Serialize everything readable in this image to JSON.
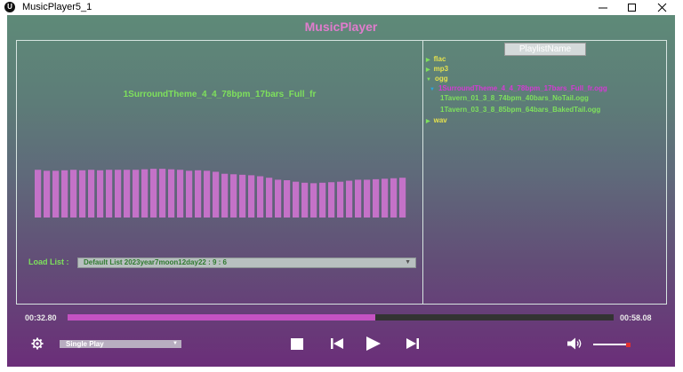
{
  "window": {
    "title": "MusicPlayer5_1",
    "icon_letter": "U"
  },
  "app": {
    "title": "MusicPlayer"
  },
  "now_playing": {
    "title": "1SurroundTheme_4_4_78bpm_17bars_Full_fr"
  },
  "spectrum": {
    "bar_color": "#c472c8",
    "levels": [
      0.96,
      0.94,
      0.94,
      0.95,
      0.96,
      0.95,
      0.96,
      0.95,
      0.96,
      0.96,
      0.96,
      0.96,
      0.97,
      0.98,
      0.98,
      0.97,
      0.96,
      0.94,
      0.95,
      0.94,
      0.92,
      0.88,
      0.87,
      0.86,
      0.85,
      0.83,
      0.8,
      0.76,
      0.75,
      0.72,
      0.7,
      0.69,
      0.7,
      0.71,
      0.72,
      0.74,
      0.76,
      0.76,
      0.77,
      0.78,
      0.79,
      0.8
    ]
  },
  "load_list": {
    "label": "Load List :",
    "value": "Default List  2023year7moon12day22 : 9 : 6"
  },
  "playlist": {
    "name": "PlaylistName",
    "folders": [
      {
        "name": "flac",
        "expanded": false
      },
      {
        "name": "mp3",
        "expanded": false
      },
      {
        "name": "ogg",
        "expanded": true
      },
      {
        "name": "wav",
        "expanded": false
      }
    ],
    "ogg_files": [
      {
        "name": "1SurroundTheme_4_4_78bpm_17bars_Full_fr.ogg",
        "selected": true
      },
      {
        "name": "1Tavern_01_3_8_74bpm_40bars_NoTail.ogg",
        "selected": false
      },
      {
        "name": "1Tavern_03_3_8_85bpm_64bars_BakedTail.ogg",
        "selected": false
      }
    ]
  },
  "playback": {
    "current_time": "00:32.80",
    "total_time": "00:58.08",
    "progress": 0.564
  },
  "controls": {
    "mode": "Single Play",
    "volume": 0.95,
    "icons": [
      "gear-icon",
      "stop-icon",
      "previous-icon",
      "play-icon",
      "next-icon",
      "speaker-icon"
    ]
  },
  "colors": {
    "accent": "#e07ccd",
    "text_green": "#7ee05c",
    "folder_yellow": "#e6e24d",
    "selected_magenta": "#d43ad4",
    "progress_fill": "#c452c2"
  }
}
